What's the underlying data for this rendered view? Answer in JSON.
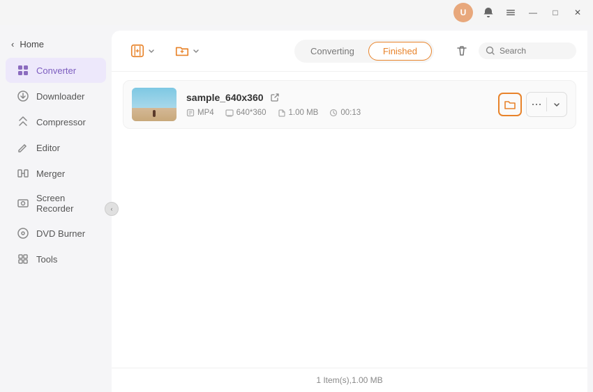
{
  "titlebar": {
    "avatar_initials": "U",
    "controls": [
      "minimize",
      "maximize",
      "close"
    ]
  },
  "sidebar": {
    "home_label": "Home",
    "items": [
      {
        "id": "converter",
        "label": "Converter",
        "active": true
      },
      {
        "id": "downloader",
        "label": "Downloader",
        "active": false
      },
      {
        "id": "compressor",
        "label": "Compressor",
        "active": false
      },
      {
        "id": "editor",
        "label": "Editor",
        "active": false
      },
      {
        "id": "merger",
        "label": "Merger",
        "active": false
      },
      {
        "id": "screen-recorder",
        "label": "Screen Recorder",
        "active": false
      },
      {
        "id": "dvd-burner",
        "label": "DVD Burner",
        "active": false
      },
      {
        "id": "tools",
        "label": "Tools",
        "active": false
      }
    ]
  },
  "toolbar": {
    "add_file_label": "",
    "add_folder_label": "",
    "tab_converting": "Converting",
    "tab_finished": "Finished",
    "search_placeholder": "Search"
  },
  "files": [
    {
      "name": "sample_640x360",
      "format": "MP4",
      "resolution": "640*360",
      "size": "1.00 MB",
      "duration": "00:13"
    }
  ],
  "statusbar": {
    "summary": "1 Item(s),1.00 MB"
  },
  "icons": {
    "home_arrow": "‹",
    "collapse": "‹",
    "add_file": "✦",
    "add_folder": "⊕",
    "trash": "🗑",
    "search": "🔍",
    "folder_open": "📁",
    "more": "···",
    "chevron_down": "▾",
    "external_link": "↗"
  }
}
